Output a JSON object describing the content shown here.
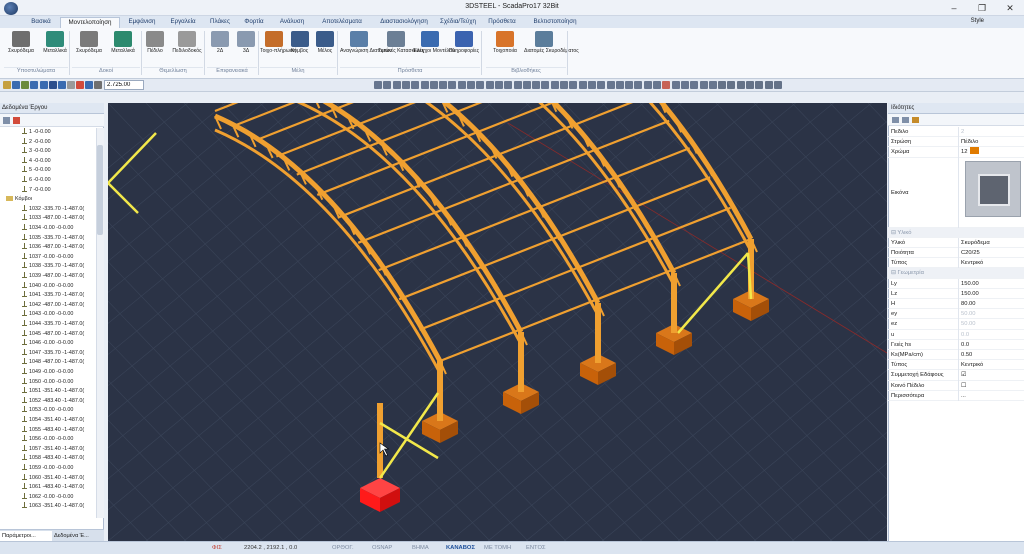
{
  "window": {
    "title": "3DSTEEL - ScadaPro17 32Bit"
  },
  "tabs": [
    "Βασικά",
    "Μοντελοποίηση",
    "Εμφάνιση",
    "Εργαλεία",
    "Πλάκες",
    "Φορτία",
    "Ανάλυση",
    "Αποτελέσματα",
    "Διαστασιολόγηση",
    "Σχέδια/Τεύχη",
    "Πρόσθετα",
    "Βελτιστοποίηση"
  ],
  "active_tab": "Μοντελοποίηση",
  "style_label": "Style",
  "ribbon": {
    "buttons": [
      {
        "label": "Σκυρόδεμα",
        "icon": "concrete-column-icon"
      },
      {
        "label": "Μεταλλικά",
        "icon": "steel-column-icon"
      },
      {
        "label": "Σκυρόδεμα",
        "icon": "concrete-beam-icon"
      },
      {
        "label": "Μεταλλικά",
        "icon": "steel-beam-icon"
      },
      {
        "label": "Πέδιλο",
        "icon": "footing-icon"
      },
      {
        "label": "Πεδιλοδοκός",
        "icon": "strip-footing-icon"
      },
      {
        "label": "2Δ",
        "icon": "surface-2d-icon"
      },
      {
        "label": "3Δ",
        "icon": "surface-3d-icon"
      },
      {
        "label": "Τοιχο-πλήρωση",
        "icon": "infill-wall-icon"
      },
      {
        "label": "Κόμβος",
        "icon": "node-icon"
      },
      {
        "label": "Μέλος",
        "icon": "member-icon"
      },
      {
        "label": "Αναγνώριση Διατομών",
        "icon": "section-recognition-icon"
      },
      {
        "label": "Τυπικές Κατασκευές",
        "icon": "typical-structures-icon"
      },
      {
        "label": "Έλεγχοι Μοντέλου",
        "icon": "model-check-icon"
      },
      {
        "label": "Πληροφορίες",
        "icon": "info-icon"
      },
      {
        "label": "Τοιχοποιία",
        "icon": "masonry-icon"
      },
      {
        "label": "Διατομές Σκυροδέματος",
        "icon": "concrete-sections-icon"
      }
    ],
    "groups": [
      "Υποστυλώματα",
      "Δοκοί",
      "Θεμελίωση",
      "Επιφανειακά",
      "Μέλη",
      "Πρόσθετα",
      "Βιβλιοθήκες"
    ]
  },
  "toolbar": {
    "zoom_value": "2.725.00"
  },
  "left_panel": {
    "title": "Δεδομένα Έργου",
    "tree": [
      "1 -0-0.00",
      "2 -0-0.00",
      "3 -0-0.00",
      "4 -0-0.00",
      "5 -0-0.00",
      "6 -0-0.00",
      "7 -0-0.00",
      "Κόμβοι",
      "1032 -335.70 -1-487.0(",
      "1033 -487.00 -1-487.0(",
      "1034 -0.00 -0-0.00",
      "1035 -335.70 -1-487.0(",
      "1036 -487.00 -1-487.0(",
      "1037 -0.00 -0-0.00",
      "1038 -335.70 -1-487.0(",
      "1039 -487.00 -1-487.0(",
      "1040 -0.00 -0-0.00",
      "1041 -335.70 -1-487.0(",
      "1042 -487.00 -1-487.0(",
      "1043 -0.00 -0-0.00",
      "1044 -335.70 -1-487.0(",
      "1045 -487.00 -1-487.0(",
      "1046 -0.00 -0-0.00",
      "1047 -335.70 -1-487.0(",
      "1048 -487.00 -1-487.0(",
      "1049 -0.00 -0-0.00",
      "1050 -0.00 -0-0.00",
      "1051 -351.40 -1-487.0(",
      "1052 -483.40 -1-487.0(",
      "1053 -0.00 -0-0.00",
      "1054 -351.40 -1-487.0(",
      "1055 -483.40 -1-487.0(",
      "1056 -0.00 -0-0.00",
      "1057 -351.40 -1-487.0(",
      "1058 -483.40 -1-487.0(",
      "1059 -0.00 -0-0.00",
      "1060 -351.40 -1-487.0(",
      "1061 -483.40 -1-487.0(",
      "1062 -0.00 -0-0.00",
      "1063 -351.40 -1-487.0("
    ],
    "bottom_tabs": [
      "Παράμετροι...",
      "Δεδομένα Έ..."
    ]
  },
  "right_panel": {
    "title": "Ιδιότητες",
    "rows": [
      {
        "k": "Πεδιλο",
        "v": "2",
        "dim": true
      },
      {
        "k": "Στρώση",
        "v": "Πέδιλο"
      },
      {
        "k": "Χρώμα",
        "v": "12"
      },
      {
        "k": "Εικόνα",
        "v": ""
      },
      {
        "k": "Υλικό",
        "v": "Σκυρόδεμα",
        "cat": "Υλικό"
      },
      {
        "k": "Ποιότητα",
        "v": "C20/25"
      },
      {
        "k": "Τύπος",
        "v": "Κεντρικό"
      },
      {
        "k": "Ly",
        "v": "150.00",
        "cat": "Γεωμετρία"
      },
      {
        "k": "Lz",
        "v": "150.00"
      },
      {
        "k": "H",
        "v": "80.00"
      },
      {
        "k": "ey",
        "v": "50.00",
        "dim": true
      },
      {
        "k": "ez",
        "v": "50.00",
        "dim": true
      },
      {
        "k": "u",
        "v": "0.0",
        "dim": true
      },
      {
        "k": "Γειές hs",
        "v": "0.0"
      },
      {
        "k": "Ks(MPa/cm)",
        "v": "0.50"
      },
      {
        "k": "Τύπος",
        "v": "Κεντρικό"
      },
      {
        "k": "Συμμετοχή Εδάφους",
        "v": "check"
      },
      {
        "k": "Κοινό Πέδιλο",
        "v": "uncheck"
      },
      {
        "k": "Περισσότερα",
        "v": "..."
      }
    ],
    "color_swatch": "#e07b00"
  },
  "status": {
    "phi": "ΦΙΣ",
    "coords": "2204.2 , 2192.1 , 0.0",
    "modes": [
      "ΟΡΘΟΓ.",
      "OSNAP",
      "ΒΗΜΑ",
      "ΚΑΝΑΒΟΣ",
      "ΜΕ ΤΟΜΗ",
      "ΕΝΤΟΣ"
    ],
    "active_mode": "ΚΑΝΑΒΟΣ"
  },
  "colors": {
    "member": "#f0a030",
    "brace": "#f2e84a",
    "footing": "#c8620a",
    "selected": "#ff1a1a",
    "background": "#2b3346",
    "grid": "#3a4458"
  }
}
